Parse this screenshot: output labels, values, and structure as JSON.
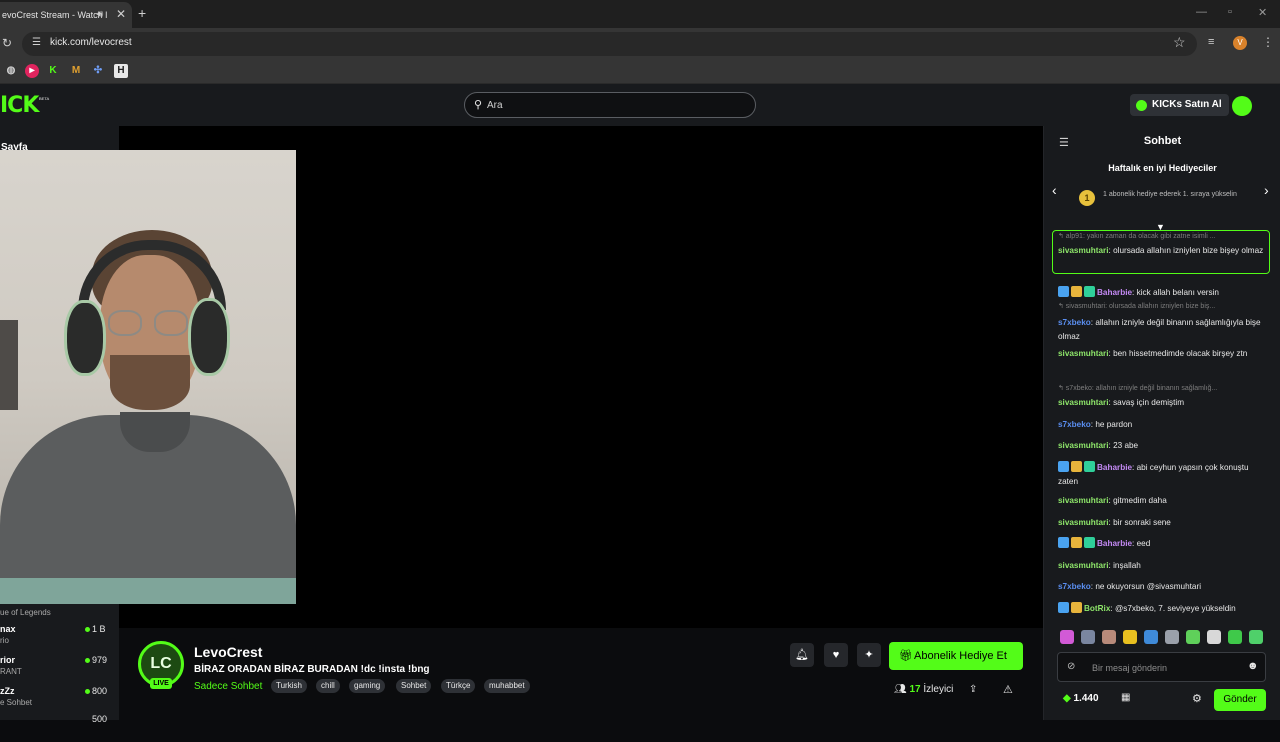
{
  "browser": {
    "tab_title": "evoCrest Stream - Watch l",
    "tab_mute_icon": "speaker-icon",
    "url": "kick.com/levocrest",
    "profile_initial": "V"
  },
  "header": {
    "logo": "ICK",
    "logo_beta": "BETA",
    "search_placeholder": "Ara",
    "kicks_button": "KICKs Satın Al"
  },
  "sidebar": {
    "title": "Sayfa",
    "items": [
      {
        "name": "",
        "sub": "ue of Legends",
        "count": ""
      },
      {
        "name": "nax",
        "sub": "rio",
        "count": "1 B"
      },
      {
        "name": "rior",
        "sub": "RANT",
        "count": "979"
      },
      {
        "name": "zZz",
        "sub": "e Sohbet",
        "count": "800"
      },
      {
        "name": "",
        "sub": "",
        "count": "500"
      }
    ]
  },
  "stream": {
    "channel_initials": "LC",
    "live_label": "LIVE",
    "channel_name": "LevoCrest",
    "title": "BİRAZ ORADAN BİRAZ BURADAN !dc !insta !bng",
    "category": "Sadece Sohbet",
    "tags": [
      "Turkish",
      "chill",
      "gaming",
      "Sohbet",
      "Türkçe",
      "muhabbet"
    ],
    "gift_button": "Abonelik Hediye Et",
    "viewer_count": "17",
    "viewer_label": "İzleyici"
  },
  "chat": {
    "title": "Sohbet",
    "gifters_title": "Haftalık en iyi Hediyeciler",
    "rank": "1",
    "gifters_text": "1 abonelik hediye ederek 1. sıraya yükselin",
    "messages": [
      {
        "kind": "reply",
        "text": "↰ alp91: yakın zaman da olacak gibi zatne isimli ..."
      },
      {
        "kind": "msg",
        "user": "sivasmuhtari",
        "color": "green",
        "badges": 0,
        "text": ": olursada allahın izniylen bize bişey olmaz"
      },
      {
        "kind": "msg",
        "user": "Baharbie",
        "color": "purple",
        "badges": 3,
        "text": ": kick allah belanı versin"
      },
      {
        "kind": "reply",
        "text": "↰ sivasmuhtari: olursada allahın izniylen bize biş..."
      },
      {
        "kind": "msg",
        "user": "s7xbeko",
        "color": "blue",
        "badges": 0,
        "text": ": allahın izniyle değil binanın sağlamlığıyla bişe olmaz"
      },
      {
        "kind": "msg",
        "user": "sivasmuhtari",
        "color": "green",
        "badges": 0,
        "text": ": ben hissetmedimde olacak birşey ztn"
      },
      {
        "kind": "reply",
        "text": "↰ s7xbeko: allahın izniyle değil binanın sağlamlığ..."
      },
      {
        "kind": "msg",
        "user": "sivasmuhtari",
        "color": "green",
        "badges": 0,
        "text": ": savaş için demiştim"
      },
      {
        "kind": "msg",
        "user": "s7xbeko",
        "color": "blue",
        "badges": 0,
        "text": ": he pardon"
      },
      {
        "kind": "msg",
        "user": "sivasmuhtari",
        "color": "green",
        "badges": 0,
        "text": ": 23 abe"
      },
      {
        "kind": "msg",
        "user": "Baharbie",
        "color": "purple",
        "badges": 3,
        "text": ": abi ceyhun yapsın çok konuştu zaten"
      },
      {
        "kind": "msg",
        "user": "sivasmuhtari",
        "color": "green",
        "badges": 0,
        "text": ": gitmedim daha"
      },
      {
        "kind": "msg",
        "user": "sivasmuhtari",
        "color": "green",
        "badges": 0,
        "text": ": bir sonraki sene"
      },
      {
        "kind": "msg",
        "user": "Baharbie",
        "color": "purple",
        "badges": 3,
        "text": ": eed"
      },
      {
        "kind": "msg",
        "user": "sivasmuhtari",
        "color": "green",
        "badges": 0,
        "text": ": inşallah"
      },
      {
        "kind": "msg",
        "user": "s7xbeko",
        "color": "blue",
        "badges": 0,
        "text": ": ne okuyorsun @sivasmuhtari"
      },
      {
        "kind": "msg",
        "user": "BotRix",
        "color": "green",
        "badges": 2,
        "text": ": @s7xbeko, 7. seviyeye yükseldin"
      }
    ],
    "input_placeholder": "Bir mesaj gönderin",
    "kicks_balance": "1.440",
    "send_button": "Gönder"
  },
  "colors": {
    "accent": "#53fc18",
    "background": "#0b0c0e",
    "panel": "#181a1d"
  }
}
